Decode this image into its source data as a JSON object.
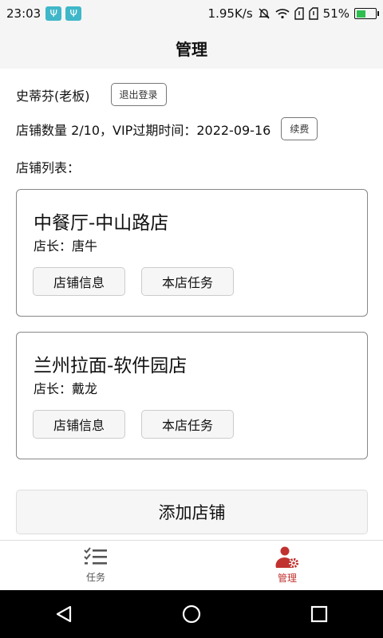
{
  "status": {
    "time": "23:03",
    "net_speed": "1.95K/s",
    "battery_pct": "51%",
    "battery_level": 0.51
  },
  "header": {
    "title": "管理"
  },
  "user": {
    "name": "史蒂芬(老板)",
    "logout_label": "退出登录",
    "store_info": "店铺数量 2/10，VIP过期时间：2022-09-16",
    "renew_label": "续费"
  },
  "store_list_label": "店铺列表：",
  "stores": [
    {
      "name": "中餐厅-中山路店",
      "manager": "店长：唐牛",
      "info_label": "店铺信息",
      "tasks_label": "本店任务"
    },
    {
      "name": "兰州拉面-软件园店",
      "manager": "店长：戴龙",
      "info_label": "店铺信息",
      "tasks_label": "本店任务"
    }
  ],
  "add_store_label": "添加店铺",
  "tabs": [
    {
      "label": "任务",
      "icon": "checklist-icon"
    },
    {
      "label": "管理",
      "icon": "user-gear-icon",
      "active": true
    }
  ],
  "colors": {
    "accent": "#c0322f",
    "battery": "#2ebd4f",
    "usb": "#3fb7c9"
  }
}
